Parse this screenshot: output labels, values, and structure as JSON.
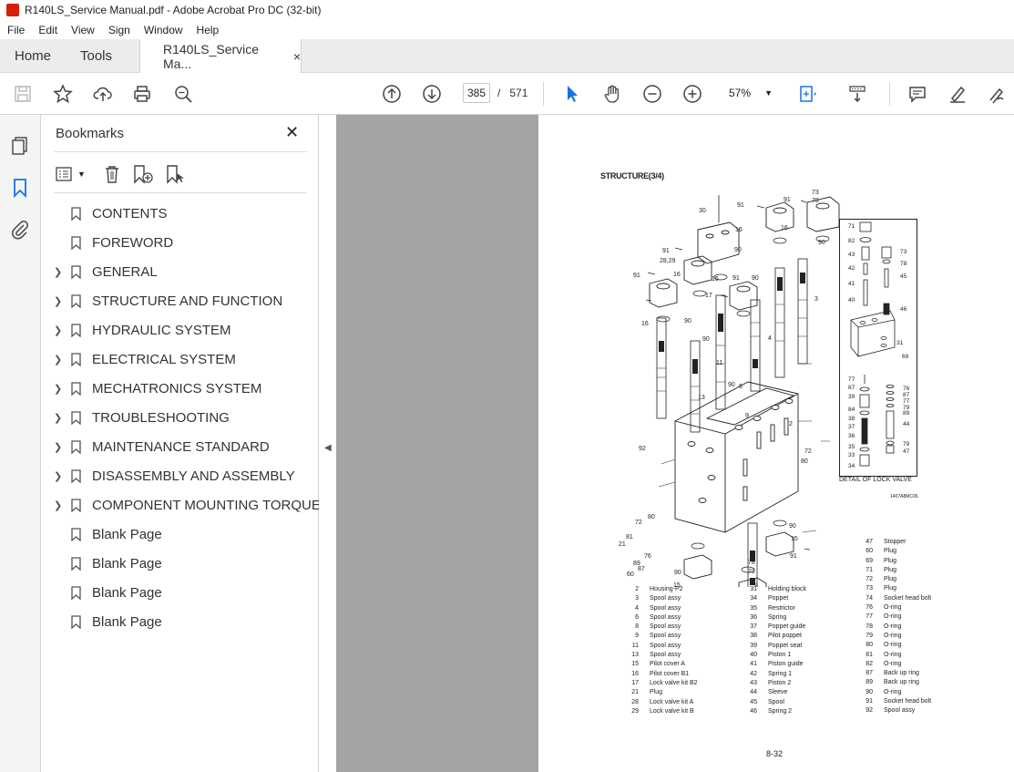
{
  "window": {
    "title": "R140LS_Service Manual.pdf - Adobe Acrobat Pro DC (32-bit)"
  },
  "menu": [
    "File",
    "Edit",
    "View",
    "Sign",
    "Window",
    "Help"
  ],
  "tabs": {
    "home": "Home",
    "tools": "Tools",
    "document": "R140LS_Service Ma...",
    "close": "×"
  },
  "toolbar": {
    "page_current": "385",
    "page_sep": "/",
    "page_total": "571",
    "zoom": "57%"
  },
  "bookmarks": {
    "title": "Bookmarks",
    "close": "✕",
    "items": [
      {
        "label": "CONTENTS",
        "expandable": false
      },
      {
        "label": "FOREWORD",
        "expandable": false
      },
      {
        "label": "GENERAL",
        "expandable": true
      },
      {
        "label": "STRUCTURE AND FUNCTION",
        "expandable": true
      },
      {
        "label": "HYDRAULIC SYSTEM",
        "expandable": true
      },
      {
        "label": "ELECTRICAL SYSTEM",
        "expandable": true
      },
      {
        "label": "MECHATRONICS SYSTEM",
        "expandable": true
      },
      {
        "label": "TROUBLESHOOTING",
        "expandable": true
      },
      {
        "label": "MAINTENANCE STANDARD",
        "expandable": true
      },
      {
        "label": "DISASSEMBLY AND ASSEMBLY",
        "expandable": true
      },
      {
        "label": "COMPONENT MOUNTING TORQUE",
        "expandable": true
      },
      {
        "label": "Blank Page",
        "expandable": false
      },
      {
        "label": "Blank Page",
        "expandable": false
      },
      {
        "label": "Blank Page",
        "expandable": false
      },
      {
        "label": "Blank Page",
        "expandable": false
      }
    ]
  },
  "pdf": {
    "heading": "STRUCTURE(3/4)",
    "detail_caption": "DETAIL OF LOCK VALVE",
    "figure_ref": "1407A8MC06",
    "page_number": "8-32",
    "parts_col1": [
      [
        "2",
        "Housing-P2"
      ],
      [
        "3",
        "Spool assy"
      ],
      [
        "4",
        "Spool assy"
      ],
      [
        "6",
        "Spool assy"
      ],
      [
        "8",
        "Spool assy"
      ],
      [
        "9",
        "Spool assy"
      ],
      [
        "11",
        "Spool assy"
      ],
      [
        "13",
        "Spool assy"
      ],
      [
        "15",
        "Pilot cover A"
      ],
      [
        "16",
        "Pilot cover B1"
      ],
      [
        "17",
        "Lock valve kit B2"
      ],
      [
        "21",
        "Plug"
      ],
      [
        "28",
        "Lock valve kit A"
      ],
      [
        "29",
        "Lock valve kit B"
      ]
    ],
    "parts_col2": [
      [
        "31",
        "Holding block"
      ],
      [
        "34",
        "Poppet"
      ],
      [
        "35",
        "Restrictor"
      ],
      [
        "36",
        "Spring"
      ],
      [
        "37",
        "Poppet guide"
      ],
      [
        "38",
        "Pilot poppet"
      ],
      [
        "39",
        "Poppet seat"
      ],
      [
        "40",
        "Piston 1"
      ],
      [
        "41",
        "Piston guide"
      ],
      [
        "42",
        "Spring 1"
      ],
      [
        "43",
        "Piston 2"
      ],
      [
        "44",
        "Sleeve"
      ],
      [
        "45",
        "Spool"
      ],
      [
        "46",
        "Spring 2"
      ]
    ],
    "parts_col3": [
      [
        "47",
        "Stopper"
      ],
      [
        "60",
        "Plug"
      ],
      [
        "69",
        "Plug"
      ],
      [
        "71",
        "Plug"
      ],
      [
        "72",
        "Plug"
      ],
      [
        "73",
        "Plug"
      ],
      [
        "74",
        "Socket head bolt"
      ],
      [
        "76",
        "O-ring"
      ],
      [
        "77",
        "O-ring"
      ],
      [
        "78",
        "O-ring"
      ],
      [
        "79",
        "O-ring"
      ],
      [
        "80",
        "O-ring"
      ],
      [
        "81",
        "O-ring"
      ],
      [
        "82",
        "O-ring"
      ],
      [
        "87",
        "Back up ring"
      ],
      [
        "89",
        "Back up ring"
      ],
      [
        "90",
        "O-ring"
      ],
      [
        "91",
        "Socket head bolt"
      ],
      [
        "92",
        "Spool assy"
      ]
    ]
  }
}
